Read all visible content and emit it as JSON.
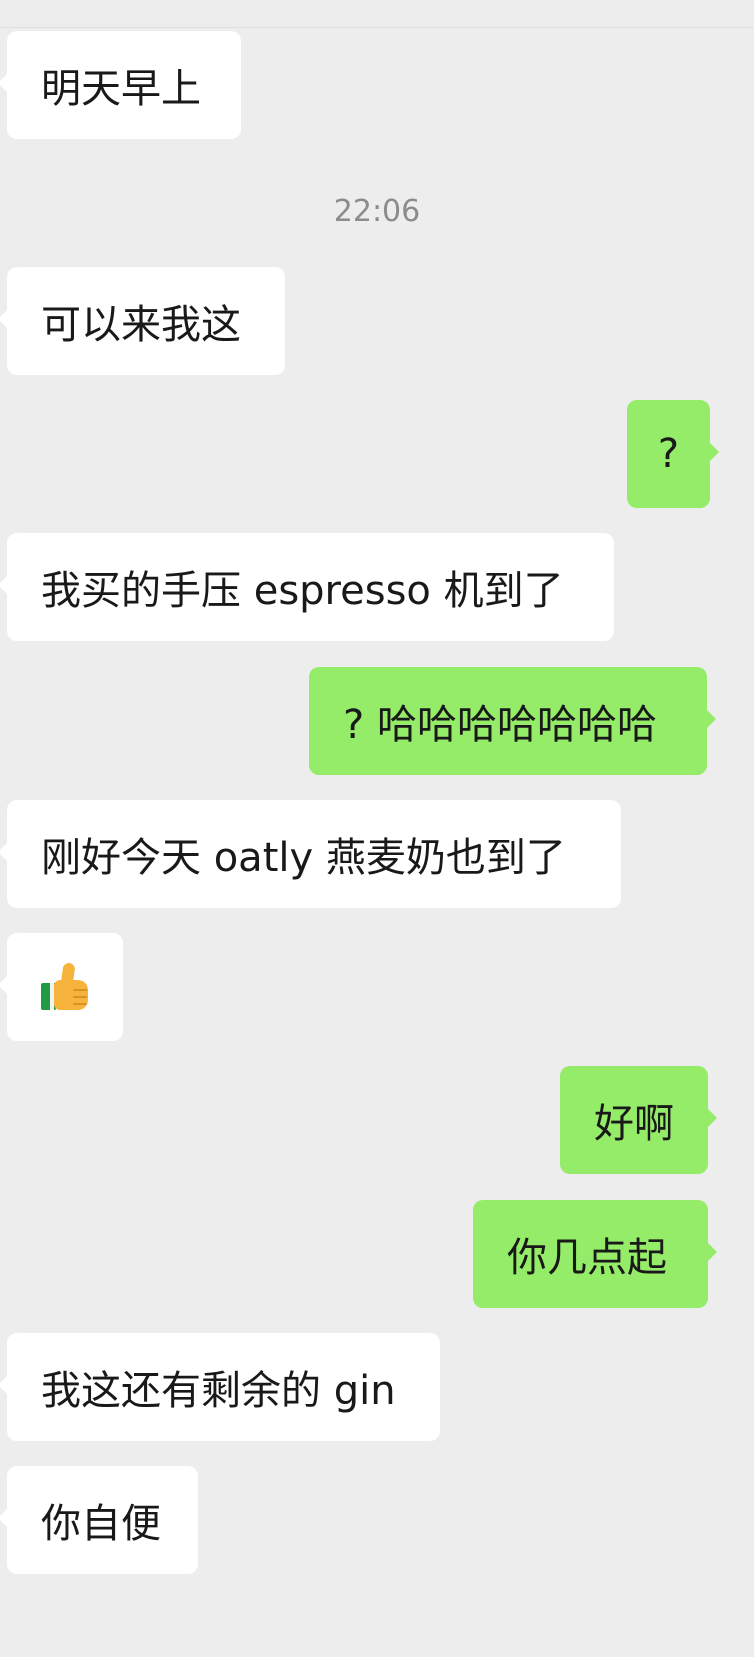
{
  "chat": {
    "timestamp": "22:06",
    "messages": [
      {
        "side": "in",
        "text": "明天早上"
      },
      {
        "side": "in",
        "text": "可以来我这"
      },
      {
        "side": "out",
        "text": "?"
      },
      {
        "side": "in",
        "text": "我买的手压 espresso 机到了"
      },
      {
        "side": "out",
        "text": "? 哈哈哈哈哈哈哈"
      },
      {
        "side": "in",
        "text": "刚好今天 oatly 燕麦奶也到了"
      },
      {
        "side": "in",
        "emoji": "thumbs-up-icon"
      },
      {
        "side": "out",
        "text": "好啊"
      },
      {
        "side": "out",
        "text": "你几点起"
      },
      {
        "side": "in",
        "text": "我这还有剩余的 gin"
      },
      {
        "side": "in",
        "text": "你自便"
      }
    ]
  },
  "colors": {
    "background": "#ededed",
    "incoming_bubble": "#ffffff",
    "outgoing_bubble": "#95ec69",
    "timestamp_text": "#8c8c8c",
    "message_text": "#191919"
  }
}
